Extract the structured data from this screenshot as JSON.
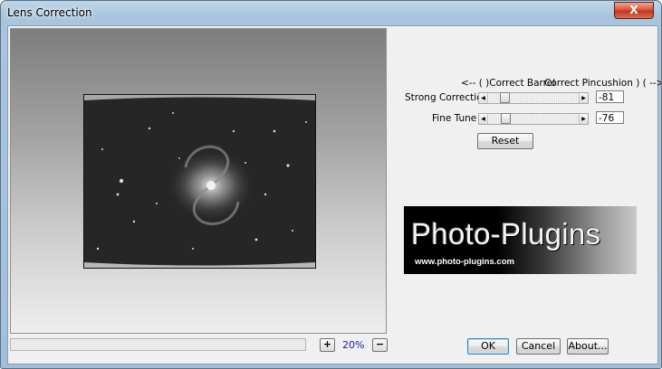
{
  "window": {
    "title": "Lens Correction",
    "close_label": "X"
  },
  "preview": {
    "zoom_label": "20%",
    "zoom_in_label": "+",
    "zoom_out_label": "−"
  },
  "controls": {
    "direction_left": "<-- ( )Correct Barrel",
    "direction_right": "Correct Pincushion ) ( -->",
    "strong_correction": {
      "label": "Strong Correction",
      "value": "-81"
    },
    "fine_tune": {
      "label": "Fine Tune",
      "value": "-76"
    },
    "reset_label": "Reset"
  },
  "banner": {
    "title": "Photo-Plugins",
    "url": "www.photo-plugins.com"
  },
  "footer": {
    "ok_label": "OK",
    "cancel_label": "Cancel",
    "about_label": "About..."
  },
  "icons": {
    "close": "close-icon",
    "scroll_left": "arrow-left-icon",
    "scroll_right": "arrow-right-icon"
  },
  "colors": {
    "close_button": "#c1361a",
    "zoom_text": "#1a1aa0",
    "default_button_border": "#3c7fb1"
  }
}
